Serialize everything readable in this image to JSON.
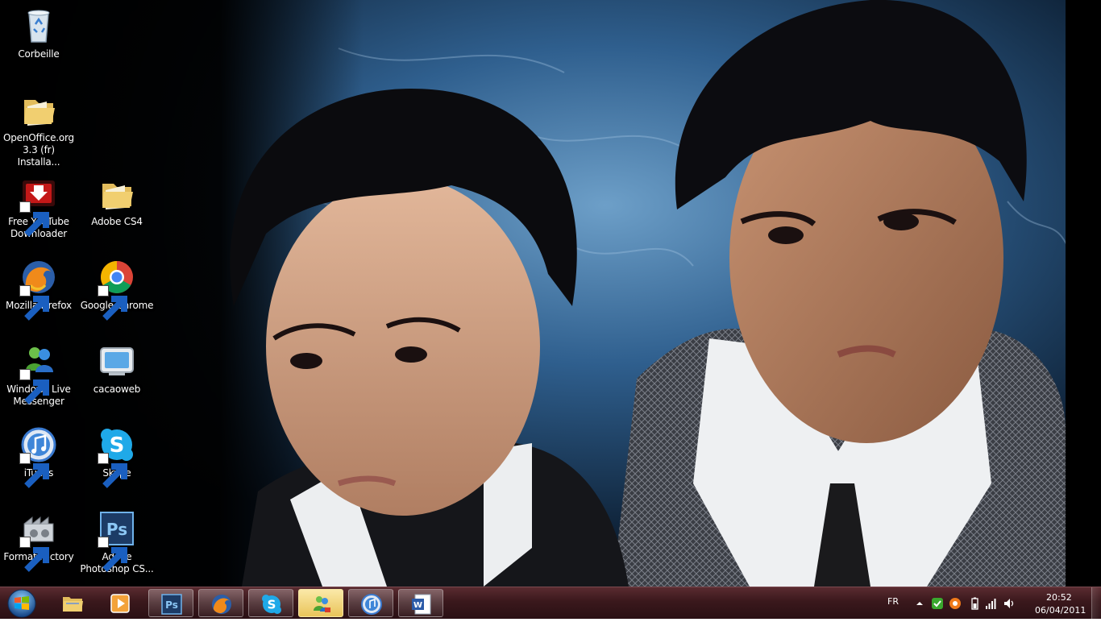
{
  "desktop": {
    "icons": [
      {
        "label": "Corbeille",
        "icon": "recycle-bin-icon"
      },
      {
        "label": "OpenOffice.org 3.3 (fr) Installa...",
        "icon": "folder-icon"
      },
      {
        "label": "Free YouTube Downloader",
        "icon": "youtube-downloader-icon"
      },
      {
        "label": "Adobe CS4",
        "icon": "folder-icon"
      },
      {
        "label": "Mozilla Firefox",
        "icon": "firefox-icon"
      },
      {
        "label": "Google Chrome",
        "icon": "chrome-icon"
      },
      {
        "label": "Windows Live Messenger",
        "icon": "messenger-icon"
      },
      {
        "label": "cacaoweb",
        "icon": "cacaoweb-icon"
      },
      {
        "label": "iTunes",
        "icon": "itunes-icon"
      },
      {
        "label": "Skype",
        "icon": "skype-icon"
      },
      {
        "label": "Format Factory",
        "icon": "format-factory-icon"
      },
      {
        "label": "Adobe Photoshop CS...",
        "icon": "photoshop-icon"
      }
    ]
  },
  "taskbar": {
    "start": {
      "icon": "windows-start-icon"
    },
    "pinned": [
      {
        "name": "explorer",
        "icon": "folder-icon",
        "state": "pinned"
      },
      {
        "name": "media-player",
        "icon": "media-player-icon",
        "state": "pinned"
      },
      {
        "name": "photoshop",
        "icon": "photoshop-icon",
        "state": "running"
      },
      {
        "name": "firefox",
        "icon": "firefox-icon",
        "state": "running"
      },
      {
        "name": "skype",
        "icon": "skype-icon",
        "state": "running"
      },
      {
        "name": "messenger",
        "icon": "messenger-icon",
        "state": "active"
      },
      {
        "name": "itunes",
        "icon": "itunes-icon",
        "state": "running"
      },
      {
        "name": "word",
        "icon": "word-icon",
        "state": "running"
      }
    ],
    "tray": {
      "language": "FR",
      "time": "20:52",
      "date": "06/04/2011",
      "icons": [
        "show-hidden-icons-icon",
        "network-status-icon",
        "avast-icon",
        "battery-icon",
        "signal-icon",
        "volume-icon"
      ]
    }
  },
  "colors": {
    "taskbar_top": "#5a2b30",
    "taskbar_bottom": "#2a1014",
    "active_task": "#e9c45a"
  }
}
